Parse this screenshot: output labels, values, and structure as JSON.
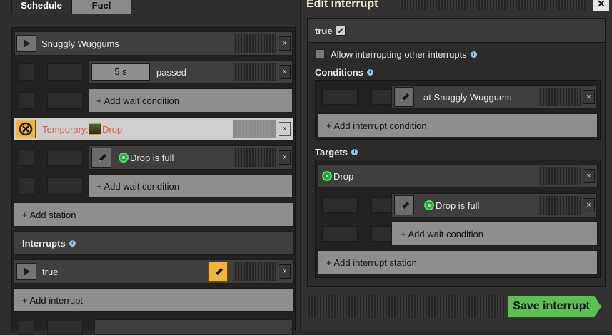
{
  "tabs": {
    "schedule": "Schedule",
    "fuel": "Fuel"
  },
  "schedule": {
    "station1": {
      "name": "Snuggly Wuggums",
      "wait_value": "5 s",
      "wait_label": "passed",
      "add_wait": "+ Add wait condition"
    },
    "temporary": {
      "prefix": "Temporary:",
      "name": "Drop",
      "condition": "Drop is full",
      "add_wait": "+ Add wait condition"
    },
    "add_station": "+ Add station",
    "interrupts_heading": "Interrupts",
    "interrupt_name": "true",
    "add_interrupt": "+ Add interrupt",
    "close_symbol": "×"
  },
  "edit_interrupt": {
    "title": "Edit interrupt",
    "name": "true",
    "allow_label": "Allow interrupting other interrupts",
    "allow_checked": false,
    "conditions_heading": "Conditions",
    "condition_text": "at Snuggly Wuggums",
    "add_interrupt_condition": "+ Add interrupt condition",
    "targets_heading": "Targets",
    "target_station": "Drop",
    "target_condition": "Drop is full",
    "add_wait": "+ Add wait condition",
    "add_interrupt_station": "+ Add interrupt station",
    "save": "Save interrupt",
    "close_symbol": "✕"
  },
  "colors": {
    "temporary_text": "#e05a4a",
    "save_green": "#5ec052",
    "accent_orange": "#f1b43c"
  }
}
